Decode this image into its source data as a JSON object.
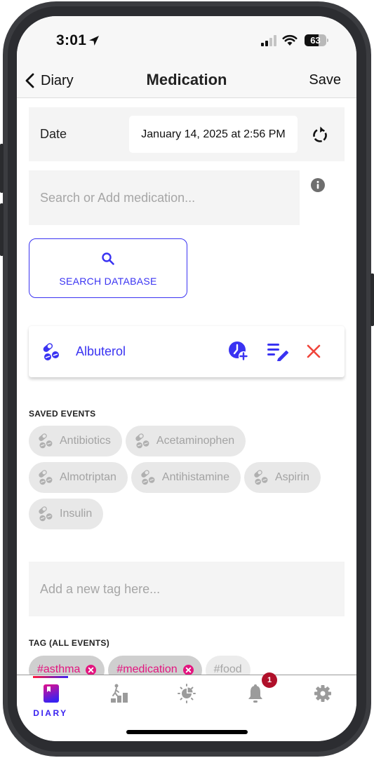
{
  "status_bar": {
    "time": "3:01",
    "battery_percent": 63,
    "battery_label": "63",
    "icons": [
      "location-arrow-icon",
      "cellular-signal-icon",
      "wifi-icon",
      "battery-icon"
    ]
  },
  "nav": {
    "back_label": "Diary",
    "title": "Medication",
    "save_label": "Save"
  },
  "form": {
    "date_label": "Date",
    "date_value": "January 14, 2025 at 2:56 PM",
    "search_placeholder": "Search or Add medication...",
    "search_value": "",
    "search_db_label": "SEARCH DATABASE"
  },
  "selected_medication": {
    "name": "Albuterol",
    "actions": [
      "add-time",
      "edit-notes",
      "remove"
    ]
  },
  "saved_events": {
    "label": "SAVED EVENTS",
    "items": [
      {
        "label": "Antibiotics"
      },
      {
        "label": "Acetaminophen"
      },
      {
        "label": "Almotriptan"
      },
      {
        "label": "Antihistamine"
      },
      {
        "label": "Aspirin"
      },
      {
        "label": "Insulin"
      }
    ]
  },
  "tags": {
    "input_placeholder": "Add a new tag here...",
    "input_value": "",
    "label": "TAG (ALL EVENTS)",
    "items": [
      {
        "label": "#asthma",
        "selected": true
      },
      {
        "label": "#medication",
        "selected": true
      },
      {
        "label": "#food",
        "selected": false
      }
    ]
  },
  "tab_bar": {
    "tabs": [
      {
        "id": "diary",
        "label": "DIARY",
        "icon": "diary-book-icon",
        "active": true
      },
      {
        "id": "progress",
        "label": "",
        "icon": "progress-stairs-icon",
        "active": false
      },
      {
        "id": "insights",
        "label": "",
        "icon": "insights-sun-chart-icon",
        "active": false
      },
      {
        "id": "alerts",
        "label": "",
        "icon": "bell-icon",
        "active": false,
        "badge": "1"
      },
      {
        "id": "settings",
        "label": "",
        "icon": "gear-icon",
        "active": false
      }
    ]
  },
  "colors": {
    "accent": "#3a33f2",
    "danger": "#f0443a",
    "tag_selected": "#e3157f",
    "badge": "#b0102a",
    "muted": "#a3a3a3"
  }
}
